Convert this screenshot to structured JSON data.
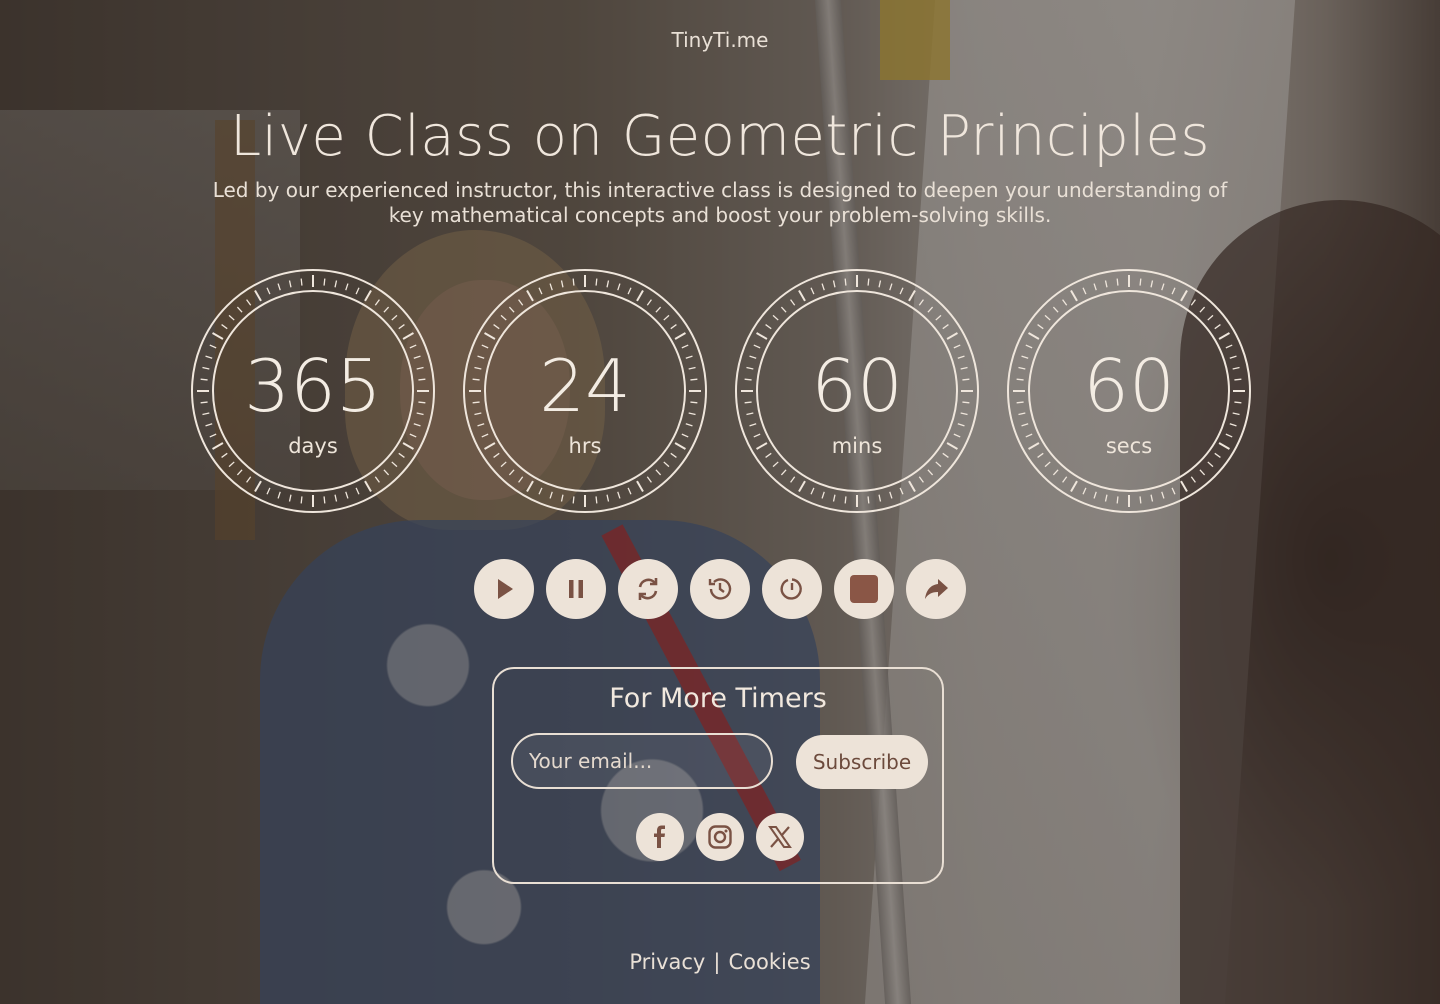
{
  "brand": "TinyTi.me",
  "title": "Live Class on Geometric Principles",
  "subtitle": "Led by our experienced instructor, this interactive class is designed to deepen your understanding of key mathematical concepts and boost your problem-solving skills.",
  "timers": [
    {
      "value": "365",
      "unit": "days"
    },
    {
      "value": "24",
      "unit": "hrs"
    },
    {
      "value": "60",
      "unit": "mins"
    },
    {
      "value": "60",
      "unit": "secs"
    }
  ],
  "controls": [
    "play-icon",
    "pause-icon",
    "refresh-icon",
    "history-icon",
    "timer-reset-icon",
    "stop-icon",
    "share-icon"
  ],
  "signup": {
    "title": "For More Timers",
    "email_placeholder": "Your email...",
    "subscribe_label": "Subscribe"
  },
  "social": [
    "facebook-icon",
    "instagram-icon",
    "x-icon"
  ],
  "footer": {
    "privacy": "Privacy",
    "separator": "|",
    "cookies": "Cookies"
  },
  "colors": {
    "text": "#efe6dc",
    "button_bg": "#ede3d8",
    "icon": "#7a5244"
  }
}
